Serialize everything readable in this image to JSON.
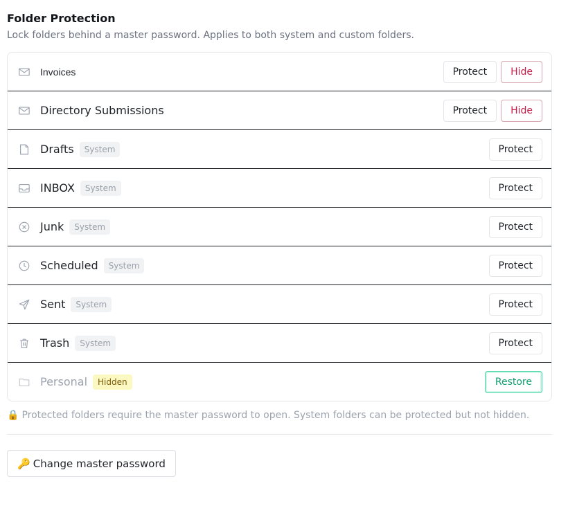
{
  "header": {
    "title": "Folder Protection",
    "subtitle": "Lock folders behind a master password. Applies to both system and custom folders."
  },
  "colors": {
    "hide_accent": "#c81e4a",
    "restore_accent": "#0f9f6e",
    "hidden_badge_bg": "#fcf8c2"
  },
  "folders": [
    {
      "name": "Invoices",
      "icon": "envelope-icon",
      "badge": "",
      "actions": [
        "Protect",
        "Hide"
      ]
    },
    {
      "name": "Directory Submissions",
      "icon": "envelope-icon",
      "badge": "",
      "actions": [
        "Protect",
        "Hide"
      ]
    },
    {
      "name": "Drafts",
      "icon": "document-icon",
      "badge": "System",
      "actions": [
        "Protect"
      ]
    },
    {
      "name": "INBOX",
      "icon": "inbox-icon",
      "badge": "System",
      "actions": [
        "Protect"
      ]
    },
    {
      "name": "Junk",
      "icon": "circle-x-icon",
      "badge": "System",
      "actions": [
        "Protect"
      ]
    },
    {
      "name": "Scheduled",
      "icon": "clock-icon",
      "badge": "System",
      "actions": [
        "Protect"
      ]
    },
    {
      "name": "Sent",
      "icon": "send-icon",
      "badge": "System",
      "actions": [
        "Protect"
      ]
    },
    {
      "name": "Trash",
      "icon": "trash-icon",
      "badge": "System",
      "actions": [
        "Protect"
      ]
    },
    {
      "name": "Personal",
      "icon": "folder-icon",
      "badge": "Hidden",
      "actions": [
        "Restore"
      ]
    }
  ],
  "labels": {
    "protect": "Protect",
    "hide": "Hide",
    "restore": "Restore",
    "system_badge": "System",
    "hidden_badge": "Hidden"
  },
  "footer": {
    "note_icon": "lock-icon",
    "note": "Protected folders require the master password to open. System folders can be protected but not hidden.",
    "change_button_icon": "key-icon",
    "change_button": "Change master password"
  }
}
